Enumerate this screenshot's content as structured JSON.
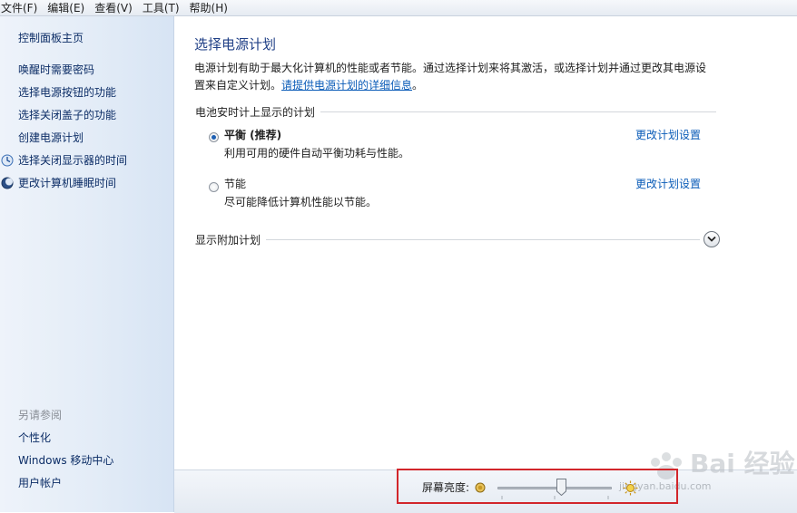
{
  "menu": [
    "文件(F)",
    "编辑(E)",
    "查看(V)",
    "工具(T)",
    "帮助(H)"
  ],
  "sidebar": {
    "home": "控制面板主页",
    "tasks": [
      "唤醒时需要密码",
      "选择电源按钮的功能",
      "选择关闭盖子的功能",
      "创建电源计划",
      "选择关闭显示器的时间",
      "更改计算机睡眠时间"
    ],
    "see_also_title": "另请参阅",
    "see_also": [
      "个性化",
      "Windows 移动中心",
      "用户帐户"
    ]
  },
  "main": {
    "title": "选择电源计划",
    "description": "电源计划有助于最大化计算机的性能或者节能。通过选择计划来将其激活，或选择计划并通过更改其电源设置来自定义计划。",
    "description_link": "请提供电源计划的详细信息",
    "description_end": "。",
    "battery_section": "电池安时计上显示的计划",
    "plans": [
      {
        "name": "平衡 (推荐)",
        "desc": "利用可用的硬件自动平衡功耗与性能。",
        "link": "更改计划设置",
        "selected": true
      },
      {
        "name": "节能",
        "desc": "尽可能降低计算机性能以节能。",
        "link": "更改计划设置",
        "selected": false
      }
    ],
    "additional_section": "显示附加计划"
  },
  "brightness": {
    "label": "屏幕亮度:",
    "level_fraction": 0.56
  },
  "watermark": {
    "text": "Bai  经验",
    "sub": "jingyan.baidu.com"
  },
  "colors": {
    "link": "#0b5cb8",
    "title": "#1f3f86",
    "highlight_box": "#d2262b"
  },
  "icons": {
    "task_shield": "shield-icon",
    "moon": "moon-icon",
    "brightness_low": "sun-dim-icon",
    "brightness_high": "sun-bright-icon",
    "expand": "chevron-down-icon"
  }
}
